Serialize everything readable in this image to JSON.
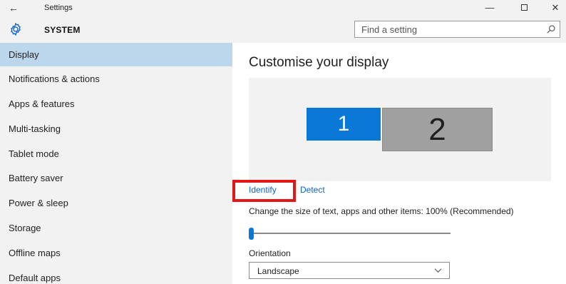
{
  "titlebar": {
    "back_glyph": "←",
    "title": "Settings",
    "minimize_glyph": "—",
    "close_glyph": "✕"
  },
  "header": {
    "section": "SYSTEM",
    "search_placeholder": "Find a setting"
  },
  "sidebar": {
    "items": [
      {
        "label": "Display",
        "active": true
      },
      {
        "label": "Notifications & actions"
      },
      {
        "label": "Apps & features"
      },
      {
        "label": "Multi-tasking"
      },
      {
        "label": "Tablet mode"
      },
      {
        "label": "Battery saver"
      },
      {
        "label": "Power & sleep"
      },
      {
        "label": "Storage"
      },
      {
        "label": "Offline maps"
      },
      {
        "label": "Default apps"
      }
    ]
  },
  "main": {
    "title": "Customise your display",
    "monitors": [
      {
        "number": "1",
        "color": "#0a78d7",
        "selected": true
      },
      {
        "number": "2",
        "color": "#a0a0a0"
      }
    ],
    "identify_label": "Identify",
    "detect_label": "Detect",
    "size_label": "Change the size of text, apps and other items: 100% (Recommended)",
    "slider_value_percent": 100,
    "orientation_label": "Orientation",
    "orientation_value": "Landscape"
  },
  "colors": {
    "accent": "#0a78d7",
    "link": "#0a63c7",
    "highlight": "#e01818",
    "sidebar_active": "#bcd6ec",
    "chrome": "#f2f2f2"
  },
  "icons": {
    "back": "back-arrow-icon",
    "gear": "gear-icon",
    "search": "search-icon",
    "chevron": "chevron-down-icon"
  }
}
